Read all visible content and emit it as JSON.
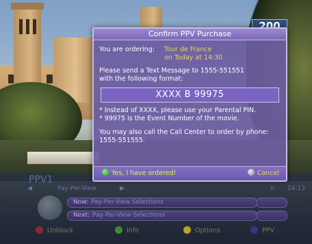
{
  "overlay": {
    "channel_number": "200",
    "channel_name": "PPV1",
    "service": "Pay-Per-View",
    "clock": "14:13"
  },
  "dialog": {
    "title": "Confirm PPV Purchase",
    "ordering_label": "You are ordering:",
    "event_title": "Tour de France",
    "event_time": "on Today at 14:30",
    "sms_line1": "Please send a Text Message to 1555-551551",
    "sms_line2": "with the following format:",
    "sms_code": "XXXX B 99975",
    "note1": "* Instead of XXXX, please use your Parental PIN.",
    "note2": "* 99975 is the Event Number of the movie.",
    "call_line1": "You may also call the Call Center to order by phone:",
    "call_line2": "1555-551555.",
    "yes_label": "Yes, I have ordered!",
    "cancel_label": "Cancel"
  },
  "epg": {
    "now_label": "Now:",
    "now_value": "Pay-Per-View Selections",
    "next_label": "Next:",
    "next_value": "Pay-Per-View Selections"
  },
  "keys": [
    {
      "label": "Unblock",
      "color": "#8a2b2b"
    },
    {
      "label": "Info",
      "color": "#3d8a33"
    },
    {
      "label": "Options",
      "color": "#b5a52e"
    },
    {
      "label": "PPV",
      "color": "#34358c"
    }
  ],
  "icons": {
    "yes": "green-button-icon",
    "cancel": "back-button-icon",
    "nav_left": "left-arrow-icon",
    "nav_right": "right-arrow-icon",
    "headphones": "headphones-icon"
  }
}
